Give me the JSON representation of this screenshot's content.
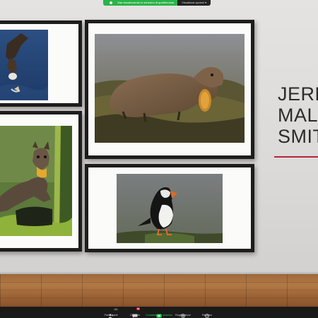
{
  "banner": {
    "status_text": "Stai visualizzando lo schermo di quattrinostra",
    "options_label": "Visualizza opzioni ▾"
  },
  "wall_title": {
    "line1": "JERE",
    "line2": "MAL",
    "line3": "SMIT",
    "rule_color": "#b0263a"
  },
  "photos": [
    {
      "subject": "eagle-photo"
    },
    {
      "subject": "otter-photo"
    },
    {
      "subject": "pine-marten-photo"
    },
    {
      "subject": "puffin-photo"
    }
  ],
  "toolbar": {
    "participants_label": "Partecipanti",
    "participants_count": "161",
    "chat_label": "Chattare",
    "chat_badge": "86",
    "share_label": "Condividere lo schermo",
    "record_label": "Registrazione",
    "reactions_label": "Reazioni",
    "share_color": "#2bd45a"
  }
}
